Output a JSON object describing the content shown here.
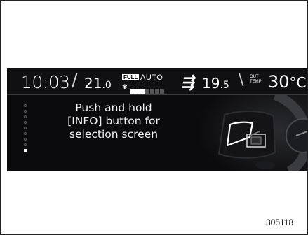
{
  "status": {
    "clock": "10:03",
    "driver_temp_int": "21",
    "driver_temp_dec": ".0",
    "full_badge": "FULL",
    "auto_label": "AUTO",
    "fan_icon": "fan-icon",
    "fan_level": 3,
    "fan_max": 7,
    "vent_icon": "vent-airflow-icon",
    "passenger_temp_int": "19",
    "passenger_temp_dec": ".5",
    "out_label_1": "OUT",
    "out_label_2": "TEMP",
    "outside_temp": "30",
    "outside_unit": "°C"
  },
  "menu": {
    "page_count": 9,
    "active_page": 9
  },
  "message": {
    "line1": "Push and hold",
    "line2": "[INFO] button for",
    "line3": "selection screen"
  },
  "figure": {
    "number": "305118"
  },
  "colors": {
    "display_bg": "#0b0b0d",
    "text": "#ffffff",
    "highlight": "#ffffff"
  }
}
